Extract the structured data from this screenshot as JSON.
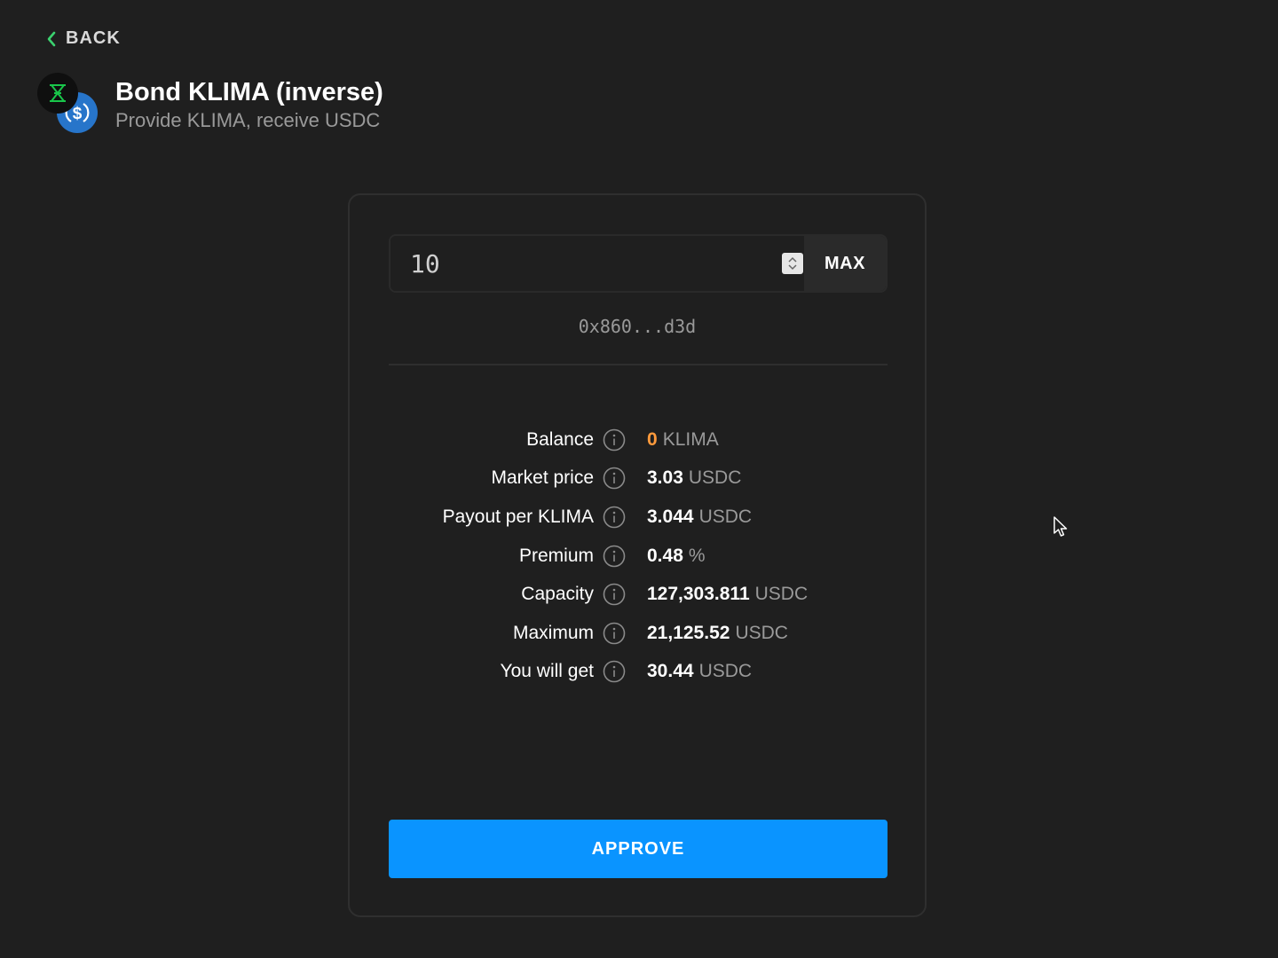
{
  "nav": {
    "back_label": "BACK"
  },
  "header": {
    "title": "Bond KLIMA (inverse)",
    "subtitle": "Provide KLIMA, receive USDC",
    "icons": [
      "klima-token-icon",
      "usdc-token-icon"
    ]
  },
  "form": {
    "amount_value": "10",
    "max_label": "MAX",
    "address": "0x860...d3d",
    "approve_label": "APPROVE"
  },
  "stats": [
    {
      "label": "Balance",
      "value": "0",
      "unit": "KLIMA"
    },
    {
      "label": "Market price",
      "value": "3.03",
      "unit": "USDC"
    },
    {
      "label": "Payout per KLIMA",
      "value": "3.044",
      "unit": "USDC"
    },
    {
      "label": "Premium",
      "value": "0.48",
      "unit": "%"
    },
    {
      "label": "Capacity",
      "value": "127,303.811",
      "unit": "USDC"
    },
    {
      "label": "Maximum",
      "value": "21,125.52",
      "unit": "USDC"
    },
    {
      "label": "You will get",
      "value": "30.44",
      "unit": "USDC"
    }
  ],
  "colors": {
    "background": "#1f1f1f",
    "accent": "#0a94ff",
    "back_chevron": "#3bd16f",
    "balance_highlight": "#ff9a3c",
    "usdc": "#2775ca"
  }
}
